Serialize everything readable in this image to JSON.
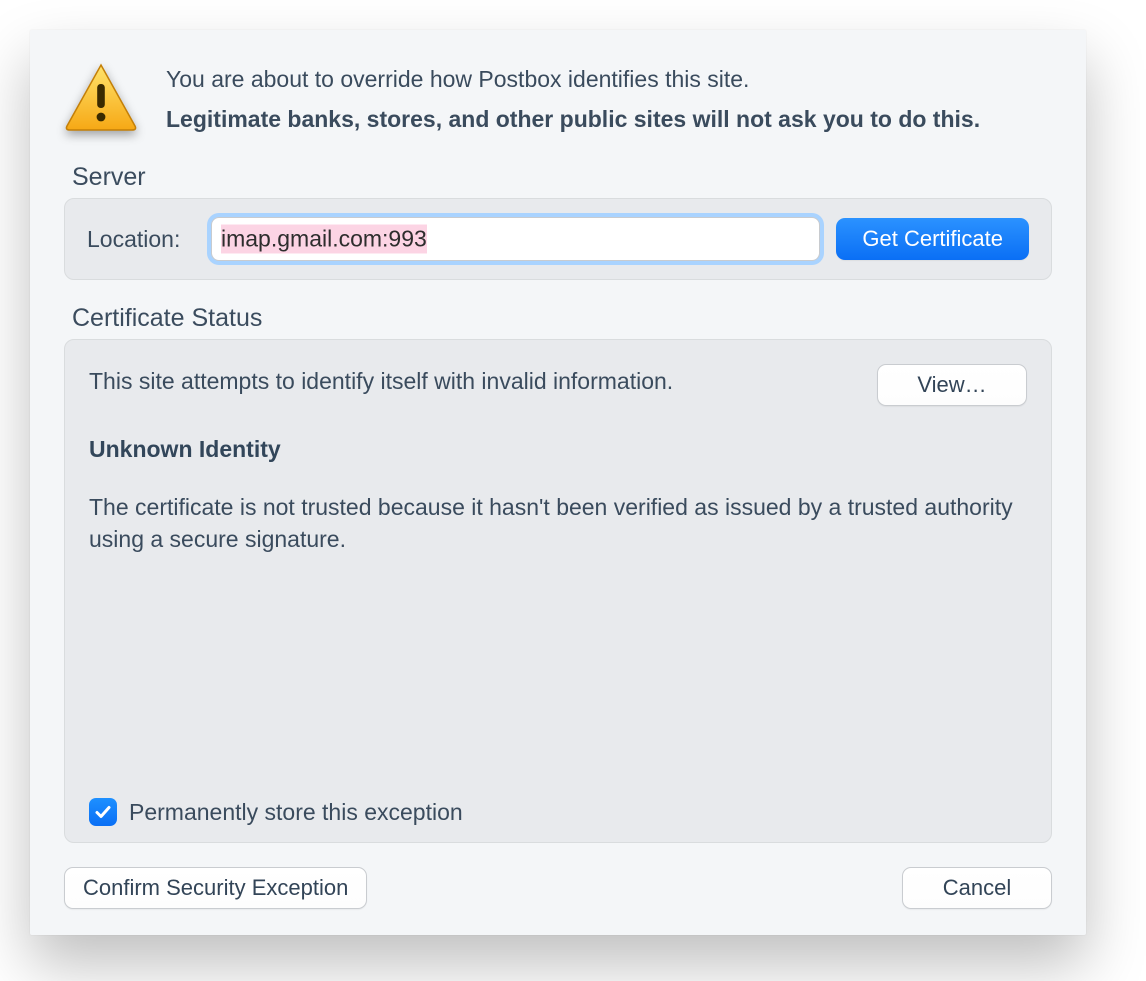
{
  "intro": {
    "line1": "You are about to override how Postbox identifies this site.",
    "line2": "Legitimate banks, stores, and other public sites will not ask you to do this."
  },
  "server": {
    "section_label": "Server",
    "location_label": "Location:",
    "location_value": "imap.gmail.com:993",
    "get_cert_label": "Get Certificate"
  },
  "status": {
    "section_label": "Certificate Status",
    "intro": "This site attempts to identify itself with invalid information.",
    "view_label": "View…",
    "heading": "Unknown Identity",
    "body": "The certificate is not trusted because it hasn't been verified as issued by a trusted authority using a secure signature."
  },
  "permanent": {
    "checked": true,
    "label": "Permanently store this exception"
  },
  "footer": {
    "confirm_label": "Confirm Security Exception",
    "cancel_label": "Cancel"
  }
}
